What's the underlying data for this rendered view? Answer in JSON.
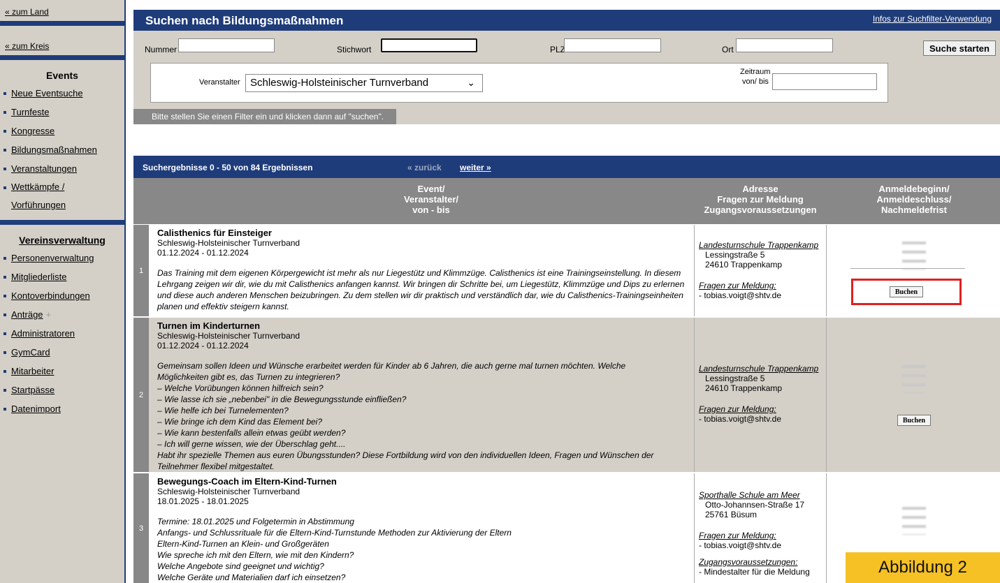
{
  "sidebar": {
    "back_land": "« zum Land",
    "back_kreis": "« zum Kreis",
    "events_heading": "Events",
    "events_items": [
      "Neue Eventsuche",
      "Turnfeste",
      "Kongresse",
      "Bildungsmaßnahmen",
      "Veranstaltungen",
      "Wettkämpfe /",
      "Vorführungen"
    ],
    "verein_heading": "Vereinsverwaltung",
    "verein_items": [
      "Personenverwaltung",
      "Mitgliederliste",
      "Kontoverbindungen",
      "Anträge",
      "Administratoren",
      "GymCard",
      "Mitarbeiter",
      "Startpässe",
      "Datenimport"
    ],
    "antraege_plus": "+"
  },
  "search": {
    "title": "Suchen nach Bildungsmaßnahmen",
    "info_link": "Infos zur Suchfilter-Verwendung",
    "labels": {
      "nummer": "Nummer",
      "stichwort": "Stichwort",
      "plz": "PLZ",
      "ort": "Ort",
      "veranstalter": "Veranstalter",
      "zeitraum": "Zeitraum",
      "vonbis": "von/ bis"
    },
    "veranstalter_value": "Schleswig-Holsteinischer Turnverband",
    "search_button": "Suche starten",
    "hint": "Bitte stellen Sie einen Filter ein und klicken dann auf \"suchen\"."
  },
  "results": {
    "count_text": "Suchergebnisse 0 - 50 von 84 Ergebnissen",
    "prev": "« zurück",
    "next": "weiter »",
    "col1": [
      "Event/",
      "Veranstalter/",
      "von - bis"
    ],
    "col2": [
      "Adresse",
      "Fragen zur Meldung",
      "Zugangsvoraussetzungen"
    ],
    "col3": [
      "Anmeldebeginn/",
      "Anmeldeschluss/",
      "Nachmeldefrist"
    ],
    "book_label": "Buchen",
    "rows": [
      {
        "num": "1",
        "title": "Calisthenics für Einsteiger",
        "org": "Schleswig-Holsteinischer Turnverband",
        "dates": "01.12.2024 - 01.12.2024",
        "desc": "Das Training mit dem eigenen Körpergewicht ist mehr als nur Liegestütz und Klimmzüge. Calisthenics ist eine Trainingseinstellung. In diesem Lehrgang zeigen wir dir, wie du mit Calisthenics anfangen kannst. Wir bringen dir Schritte bei, um Liegestütz, Klimmzüge und Dips zu erlernen und diese auch anderen Menschen beizubringen. Zu dem stellen wir dir praktisch und verständlich dar, wie du Calisthenics-Trainingseinheiten planen und effektiv steigern kannst.",
        "place": "Landesturnschule Trappenkamp",
        "street": "Lessingstraße 5",
        "city": "24610 Trappenkamp",
        "fragen_label": "Fragen zur Meldung:",
        "fragen": "- tobias.voigt@shtv.de"
      },
      {
        "num": "2",
        "title": "Turnen im Kinderturnen",
        "org": "Schleswig-Holsteinischer Turnverband",
        "dates": "01.12.2024 - 01.12.2024",
        "desc_lines": [
          "Gemeinsam sollen Ideen und Wünsche erarbeitet werden für Kinder ab 6 Jahren, die auch gerne mal turnen möchten. Welche",
          "Möglichkeiten gibt es, das Turnen zu integrieren?",
          "– Welche Vorübungen können hilfreich sein?",
          "– Wie lasse ich sie „nebenbei\" in die Bewegungsstunde einfließen?",
          "– Wie helfe ich bei Turnelementen?",
          "– Wie bringe ich dem Kind das Element bei?",
          "– Wie kann bestenfalls allein etwas geübt werden?",
          "– Ich will gerne wissen, wie der Überschlag geht....",
          "Habt ihr spezielle Themen aus euren Übungsstunden? Diese Fortbildung wird von den individuellen Ideen, Fragen und Wünschen der",
          "Teilnehmer flexibel mitgestaltet."
        ],
        "place": "Landesturnschule Trappenkamp",
        "street": "Lessingstraße 5",
        "city": "24610 Trappenkamp",
        "fragen_label": "Fragen zur Meldung:",
        "fragen": "- tobias.voigt@shtv.de"
      },
      {
        "num": "3",
        "title": "Bewegungs-Coach im Eltern-Kind-Turnen",
        "org": "Schleswig-Holsteinischer Turnverband",
        "dates": "18.01.2025 - 18.01.2025",
        "desc_lines": [
          "Termine: 18.01.2025 und Folgetermin in Abstimmung",
          "Anfangs- und Schlussrituale für die Eltern-Kind-Turnstunde Methoden zur Aktivierung der Eltern",
          "Eltern-Kind-Turnen an Klein- und Großgeräten",
          "Wie spreche ich mit den Eltern, wie mit den Kindern?",
          "Welche Angebote sind geeignet und wichtig?",
          "Welche Geräte und Materialien darf ich einsetzen?"
        ],
        "place": "Sporthalle Schule am Meer",
        "street": "Otto-Johannsen-Straße 17",
        "city": "25761 Büsum",
        "fragen_label": "Fragen zur Meldung:",
        "fragen": "- tobias.voigt@shtv.de",
        "zugang_label": "Zugangsvoraussetzungen:",
        "zugang": "- Mindestalter für die Meldung"
      }
    ]
  },
  "caption": "Abbildung 2",
  "colors": {
    "navy": "#1f3c7a",
    "gray": "#888888",
    "panel": "#d4d0c8",
    "highlight": "#e02020",
    "caption_bg": "#f5c125"
  }
}
